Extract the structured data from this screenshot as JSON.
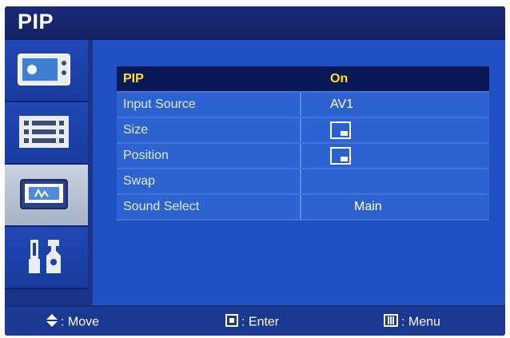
{
  "title": "PIP",
  "sidebar": {
    "items": [
      {
        "icon": "picture-icon",
        "active": false
      },
      {
        "icon": "sound-icon",
        "active": false
      },
      {
        "icon": "pip-icon",
        "active": true
      },
      {
        "icon": "setup-tools-icon",
        "active": false
      }
    ]
  },
  "menu": {
    "rows": [
      {
        "label": "PIP",
        "value": "On",
        "highlighted": true
      },
      {
        "label": "Input Source",
        "value": "AV1"
      },
      {
        "label": "Size",
        "value": "",
        "value_icon": "pip-window-icon"
      },
      {
        "label": "Position",
        "value": "",
        "value_icon": "pip-window-icon"
      },
      {
        "label": "Swap",
        "value": ""
      },
      {
        "label": "Sound Select",
        "value": "Main"
      }
    ]
  },
  "footer": {
    "move_label": ": Move",
    "enter_label": ": Enter",
    "menu_label": ": Menu"
  },
  "colors": {
    "osd_background": "#1d3fa0",
    "highlight_background": "#0b1857",
    "highlight_text": "#ffe21a",
    "row_background": "#2d63d1"
  }
}
